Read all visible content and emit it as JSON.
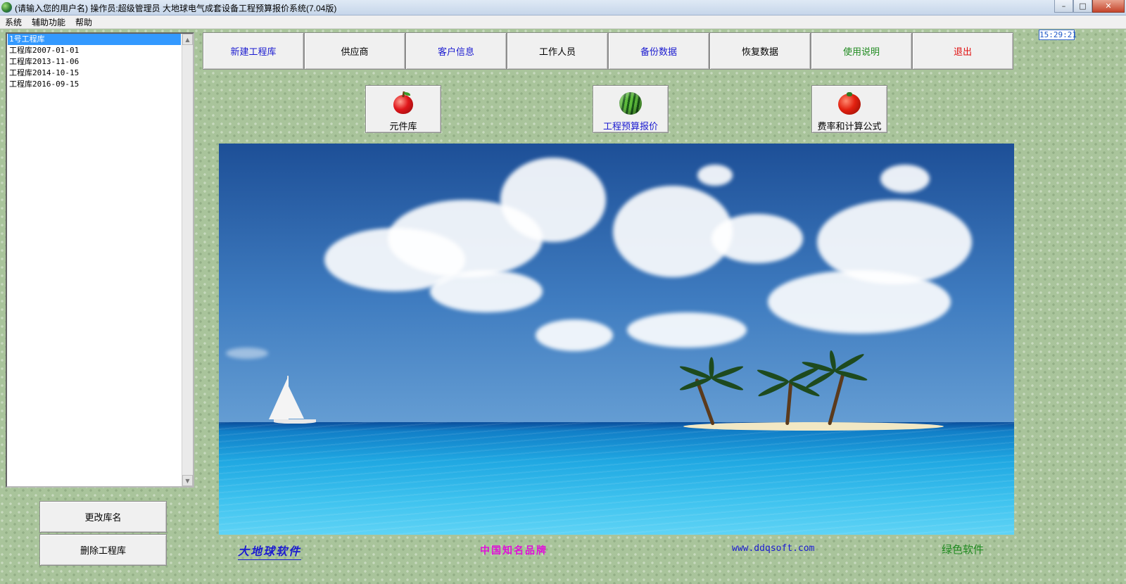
{
  "window": {
    "title": "(请输入您的用户名)   操作员:超级管理员   大地球电气成套设备工程预算报价系统(7.04版)",
    "controls": {
      "minimize": "–",
      "maximize": "□",
      "close": "✕"
    }
  },
  "menu": [
    "系统",
    "辅助功能",
    "帮助"
  ],
  "library_list": {
    "items": [
      "1号工程库",
      "工程库2007-01-01",
      "工程库2013-11-06",
      "工程库2014-10-15",
      "工程库2016-09-15"
    ],
    "selected_index": 0
  },
  "left_buttons": {
    "rename": "更改库名",
    "delete": "删除工程库"
  },
  "toolbar": [
    {
      "label": "新建工程库",
      "color": "#1b1bd0"
    },
    {
      "label": "供应商",
      "color": "#000000"
    },
    {
      "label": "客户信息",
      "color": "#1b1bd0"
    },
    {
      "label": "工作人员",
      "color": "#000000"
    },
    {
      "label": "备份数据",
      "color": "#1b1bd0"
    },
    {
      "label": "恢复数据",
      "color": "#000000"
    },
    {
      "label": "使用说明",
      "color": "#1f8a1f"
    },
    {
      "label": "退出",
      "color": "#e01010"
    }
  ],
  "clock": "15:29:21",
  "icon_buttons": {
    "components": {
      "label": "元件库",
      "icon": "apple-icon",
      "color": "#000000"
    },
    "budget": {
      "label": "工程预算报价",
      "icon": "watermelon-icon",
      "color": "#1b1bd0"
    },
    "rates": {
      "label": "费率和计算公式",
      "icon": "tomato-icon",
      "color": "#000000"
    }
  },
  "footer": {
    "brand": "大地球软件",
    "slogan": "中国知名品牌",
    "website": "www.ddqsoft.com",
    "green": "绿色软件"
  }
}
